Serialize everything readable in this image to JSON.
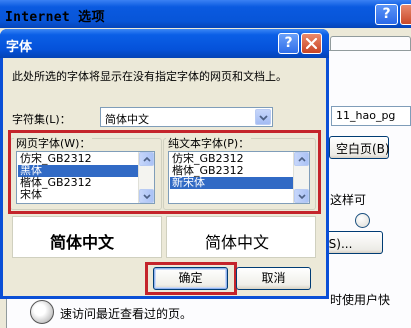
{
  "background_window": {
    "title": "Internet 选项",
    "url_fragment": "11_hao_pg",
    "blank_page_button": "空白页(B)",
    "text_fragment_1": "这样可",
    "settings_button": "置(S)...",
    "text_fragment_2": "时使用户快",
    "history_text": "速访问最近查看过的页。"
  },
  "dialog": {
    "title": "字体",
    "description": "此处所选的字体将显示在没有指定字体的网页和文档上。",
    "charset": {
      "label": "字符集(L)：",
      "value": "简体中文"
    },
    "web_font": {
      "label": "网页字体(W)：",
      "items": [
        "仿宋_GB2312",
        "黑体",
        "楷体_GB2312",
        "宋体"
      ],
      "selected_index": 1,
      "preview": "简体中文"
    },
    "plain_font": {
      "label": "纯文本字体(P)：",
      "items": [
        "仿宋_GB2312",
        "楷体_GB2312",
        "新宋体"
      ],
      "selected_index": 2,
      "preview": "简体中文"
    },
    "ok_button": "确定",
    "cancel_button": "取消"
  },
  "colors": {
    "titlebar_blue": "#0a5ae0",
    "selection": "#316ac5",
    "highlight_box": "#c4242b",
    "dialog_face": "#ece9d8"
  },
  "icons": [
    "help-icon",
    "close-icon",
    "dropdown-arrow-icon",
    "scroll-up-icon",
    "scroll-down-icon",
    "history-icon"
  ]
}
